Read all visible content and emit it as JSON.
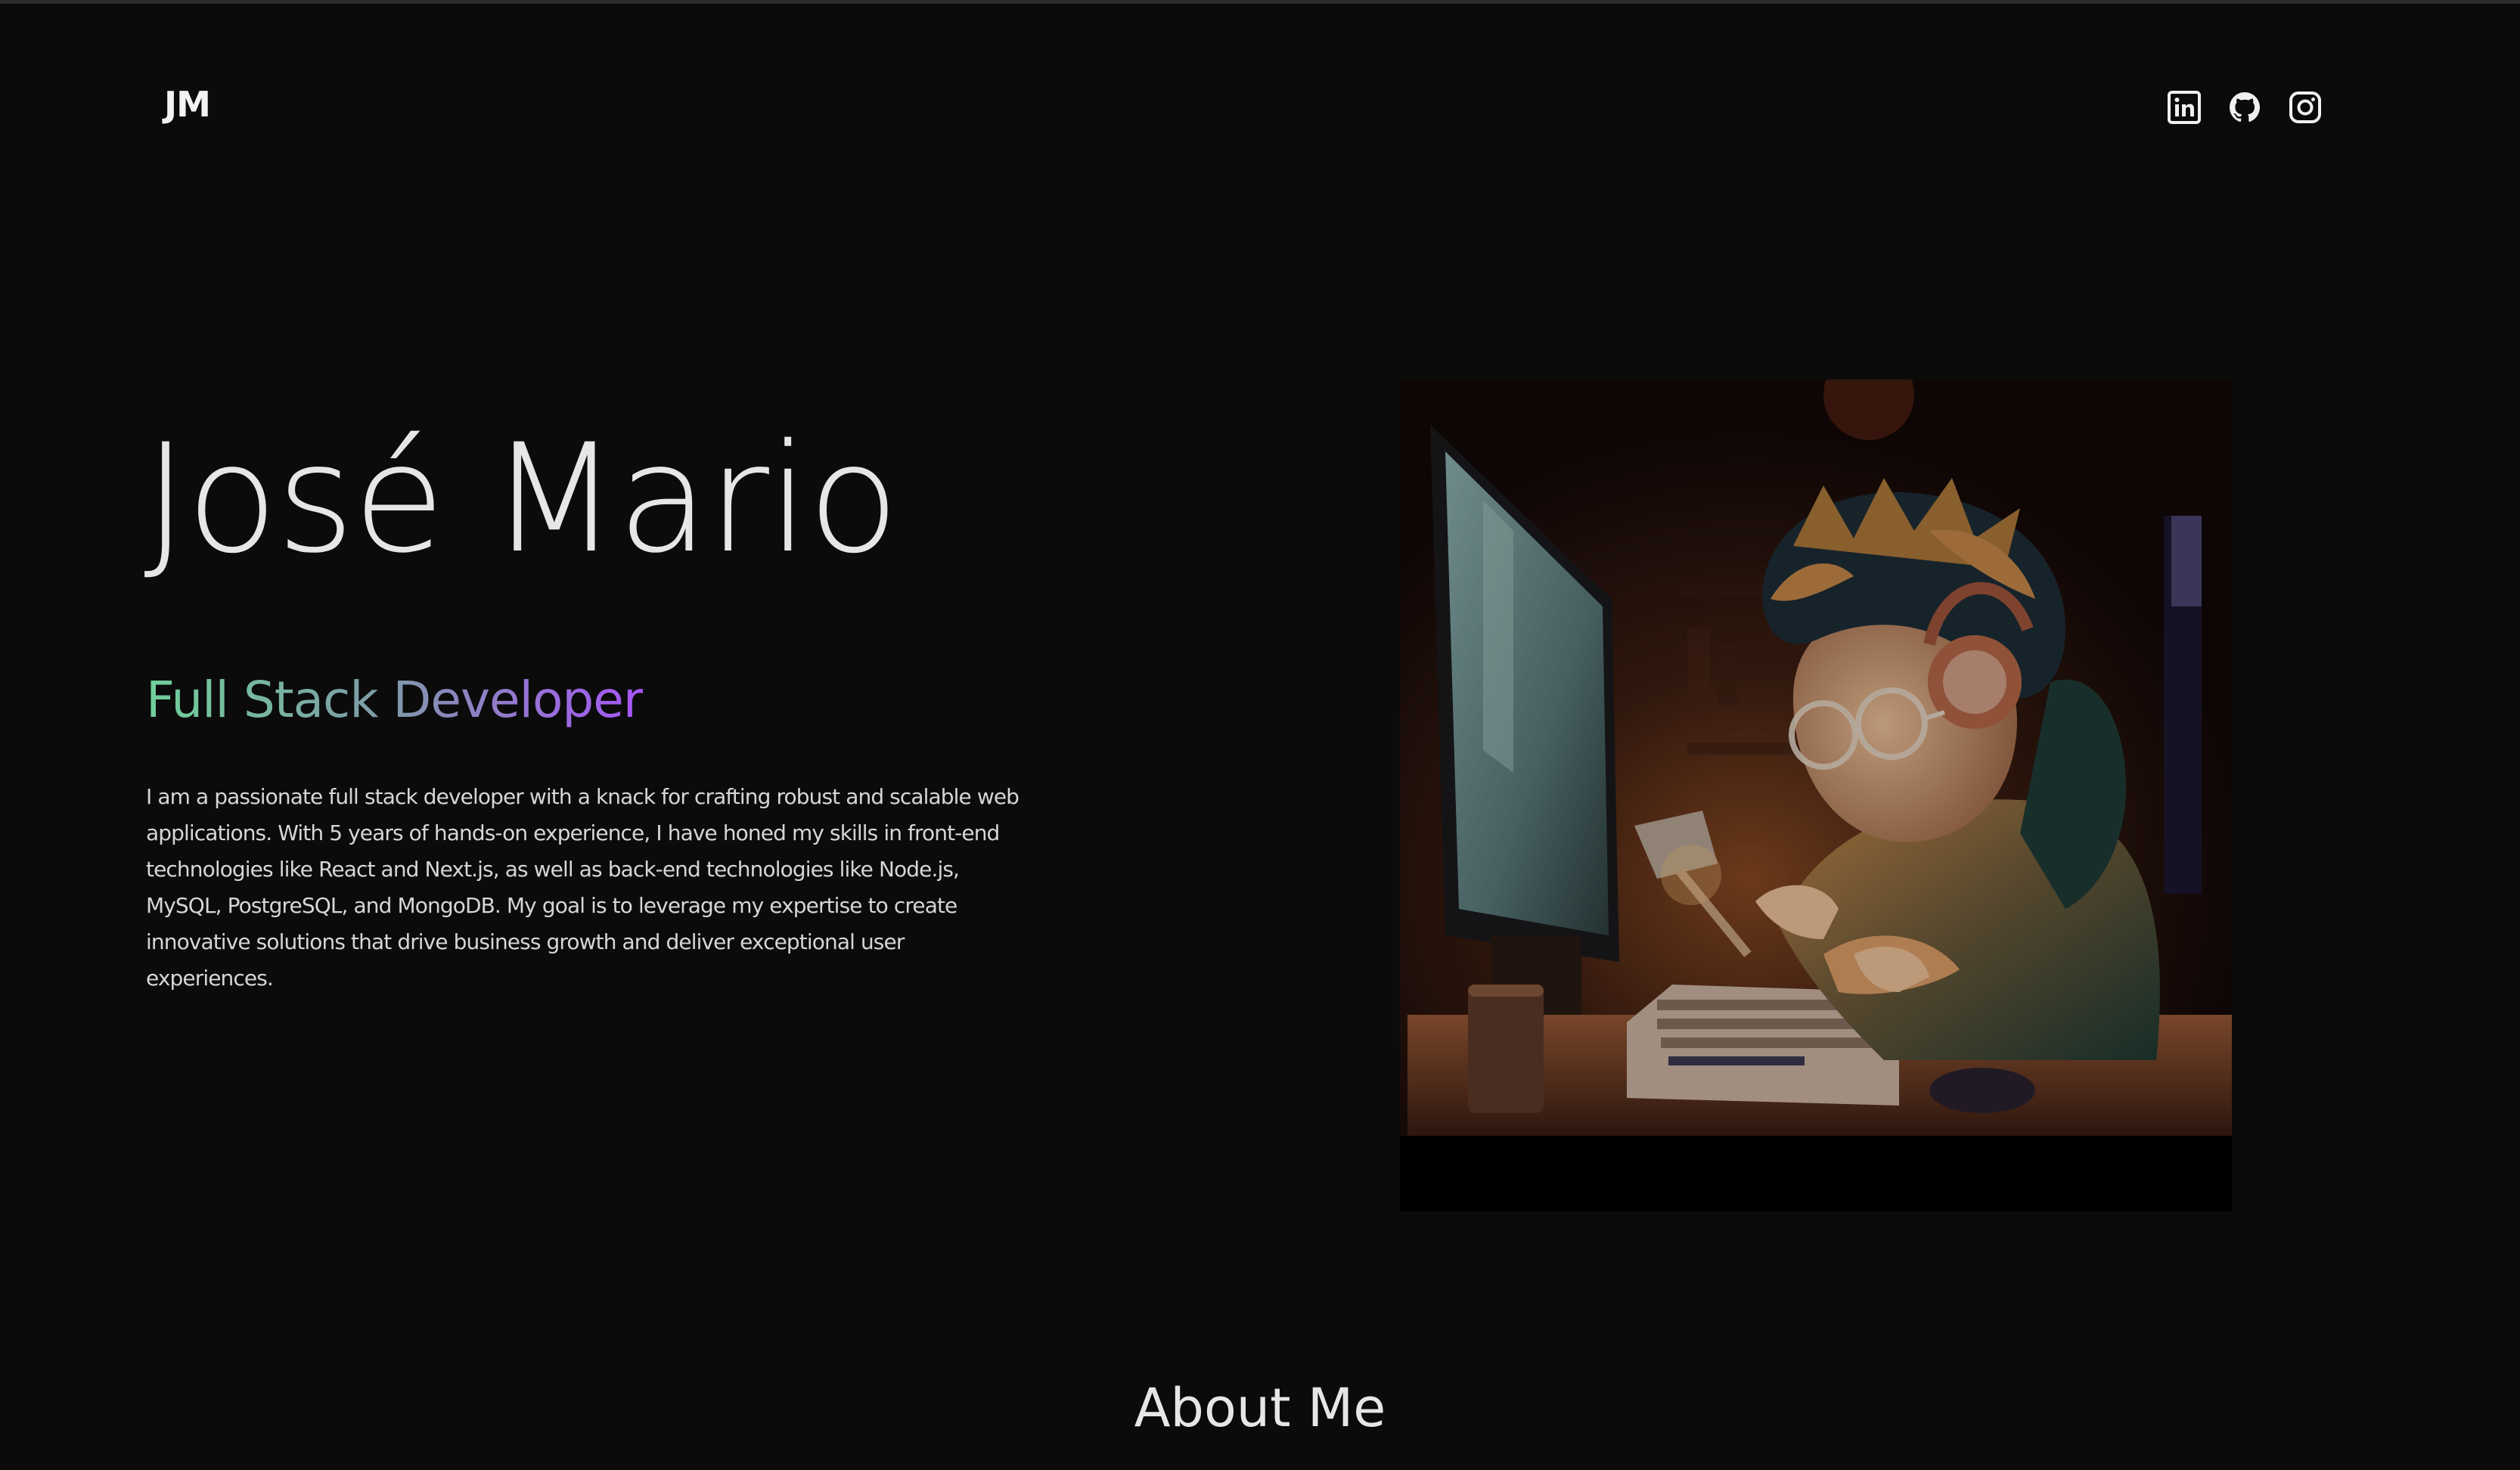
{
  "header": {
    "logo_text": "JM",
    "social_links": [
      {
        "name": "LinkedIn",
        "icon": "linkedin-icon"
      },
      {
        "name": "GitHub",
        "icon": "github-icon"
      },
      {
        "name": "Instagram",
        "icon": "instagram-icon"
      }
    ]
  },
  "hero": {
    "name": "José Mario",
    "role": "Full Stack Developer",
    "bio": "I am a passionate full stack developer with a knack for crafting robust and scalable web applications. With 5 years of hands-on experience, I have honed my skills in front-end technologies like React and Next.js, as well as back-end technologies like Node.js, MySQL, PostgreSQL, and MongoDB. My goal is to leverage my expertise to create innovative solutions that drive business growth and deliver exceptional user experiences.",
    "image": "illustration of a young developer with glasses and headphones typing at a computer in a dark room"
  },
  "about": {
    "title": "About Me"
  },
  "colors": {
    "background": "#0b0b0b",
    "text": "#e6e6e6",
    "gradient_start": "#6fd09a",
    "gradient_end": "#a855f7"
  }
}
